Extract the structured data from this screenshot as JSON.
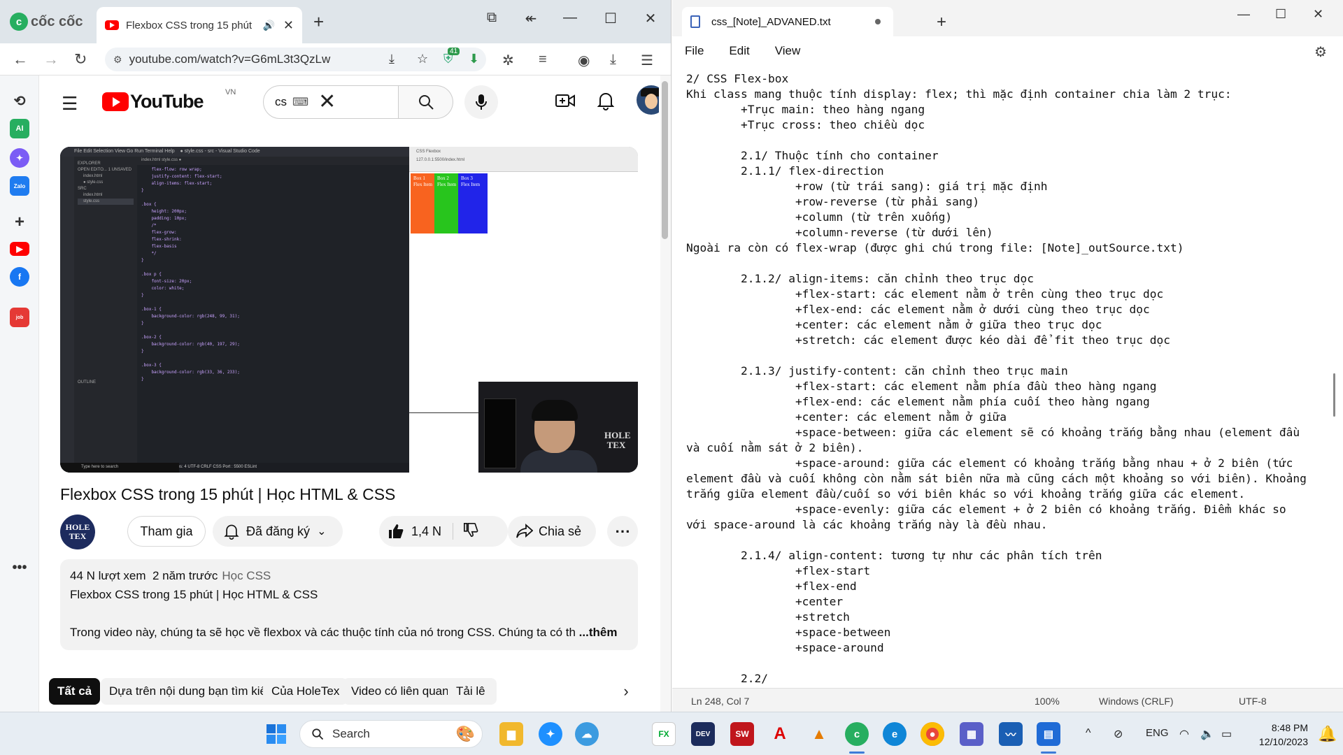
{
  "browser": {
    "brand": "cốc cốc",
    "tab_title": "Flexbox CSS trong 15 phút",
    "url": "youtube.com/watch?v=G6mL3t3QzLw",
    "extension_badge": "41"
  },
  "youtube": {
    "logo_text": "YouTube",
    "region": "VN",
    "search_query": "cs",
    "video": {
      "title": "Flexbox CSS trong 15 phút | Học HTML & CSS",
      "channel_avatar_text": "HOLE TEX",
      "join_label": "Tham gia",
      "subscribed_label": "Đã đăng ký",
      "likes": "1,4 N",
      "share_label": "Chia sẻ",
      "views": "44 N lượt xem",
      "age": "2 năm trước",
      "tag": "Học CSS",
      "desc_title": "Flexbox CSS trong 15 phút | Học HTML & CSS",
      "desc_text": "Trong video này, chúng ta sẽ học về flexbox và các thuộc tính của nó trong CSS. Chúng ta có th",
      "desc_more": "...thêm"
    },
    "chips": [
      "Tất cả",
      "Dựa trên nội dung bạn tìm kiếm",
      "Của HoleTex",
      "Video có liên quan",
      "Tải lê"
    ],
    "player": {
      "vs_title": "● style.css - src - Visual Studio Code",
      "vs_menu": "File   Edit   Selection   View   Go   Run   Terminal   Help",
      "explorer": [
        "EXPLORER",
        "OPEN EDITO... 1 UNSAVED",
        "index.html",
        "● style.css",
        "SRC",
        "index.html",
        "style.css",
        "OUTLINE"
      ],
      "editor_tabs": "index.html     style.css ●",
      "code": "    flex-flow: row wrap;\n    justify-content: flex-start;\n    align-items: flex-start;\n}\n\n.box {\n    height: 200px;\n    padding: 10px;\n    /*\n    flex-grow:\n    flex-shrink:\n    flex-basis\n    */\n}\n\n.box p {\n    font-size: 20px;\n    color: white;\n}\n\n.box-1 {\n    background-color: rgb(248, 99, 31);\n}\n\n.box-2 {\n    background-color: rgb(40, 197, 29);\n}\n\n.box-3 {\n    background-color: rgb(33, 36, 233);\n}",
      "vs_status": "Ln 23, Col 9   Spaces: 4   UTF-8   CRLF   CSS   Port : 5500   ESLint",
      "taskbar_search": "Type here to search",
      "chrome_tab": "CSS Flexbox",
      "chrome_url": "127.0.0.1:5500/index.html",
      "boxes": [
        {
          "label": "Box 1\nFlex Item",
          "color": "#f8631f"
        },
        {
          "label": "Box 2\nFlex Item",
          "color": "#28c51d"
        },
        {
          "label": "Box 3\nFlex Item",
          "color": "#2124e9"
        }
      ],
      "cam_logo": "HOLE TEX"
    }
  },
  "notepad": {
    "tab_title": "css_[Note]_ADVANED.txt",
    "menu": [
      "File",
      "Edit",
      "View"
    ],
    "content": "2/ CSS Flex-box\nKhi class mang thuộc tính display: flex; thì mặc định container chia làm 2 trục:\n        +Trục main: theo hàng ngang\n        +Trục cross: theo chiều dọc\n\n        2.1/ Thuộc tính cho container\n        2.1.1/ flex-direction\n                +row (từ trái sang): giá trị mặc định\n                +row-reverse (từ phải sang)\n                +column (từ trên xuống)\n                +column-reverse (từ dưới lên)\nNgoài ra còn có flex-wrap (được ghi chú trong file: [Note]_outSource.txt)\n\n        2.1.2/ align-items: căn chỉnh theo trục dọc\n                +flex-start: các element nằm ở trên cùng theo trục dọc\n                +flex-end: các element nằm ở dưới cùng theo trục dọc\n                +center: các element nằm ở giữa theo trục dọc\n                +stretch: các element được kéo dài để fit theo trục dọc\n\n        2.1.3/ justify-content: căn chỉnh theo trục main\n                +flex-start: các element nằm phía đầu theo hàng ngang\n                +flex-end: các element nằm phía cuối theo hàng ngang\n                +center: các element nằm ở giữa\n                +space-between: giữa các element sẽ có khoảng trắng bằng nhau (element đầu\nvà cuối nằm sát ở 2 biên).\n                +space-around: giữa các element có khoảng trắng bằng nhau + ở 2 biên (tức\nelement đầu và cuối không còn nằm sát biên nữa mà cũng cách một khoảng so với biên). Khoảng\ntrắng giữa element đầu/cuối so với biên khác so với khoảng trắng giữa các element.\n                +space-evenly: giữa các element + ở 2 biên có khoảng trắng. Điểm khác so\nvới space-around là các khoảng trắng này là đều nhau.\n\n        2.1.4/ align-content: tương tự như các phân tích trên\n                +flex-start\n                +flex-end\n                +center\n                +stretch\n                +space-between\n                +space-around\n\n        2.2/",
    "status": {
      "position": "Ln 248, Col 7",
      "zoom": "100%",
      "line_ending": "Windows (CRLF)",
      "encoding": "UTF-8"
    }
  },
  "taskbar": {
    "search_label": "Search",
    "language": "ENG",
    "time": "8:48 PM",
    "date": "12/10/2023"
  }
}
